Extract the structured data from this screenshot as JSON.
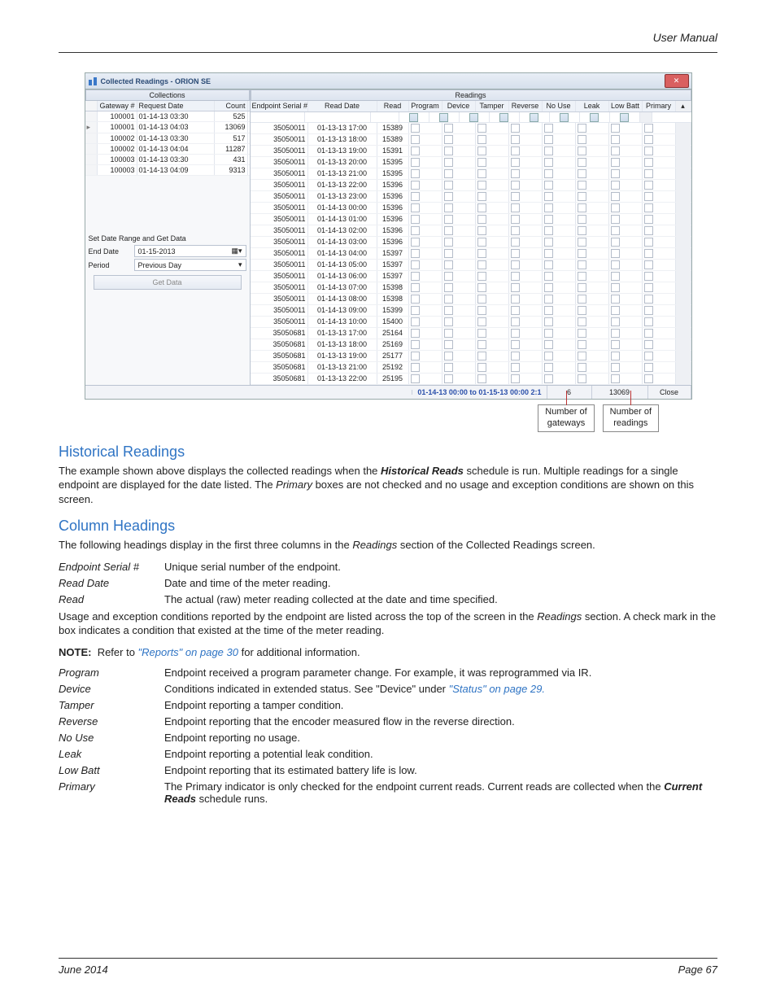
{
  "header": {
    "right": "User Manual"
  },
  "window": {
    "title": "Collected Readings - ORION SE",
    "panes": {
      "left": "Collections",
      "right": "Readings"
    },
    "left": {
      "columns": [
        "Gateway #",
        "Request Date",
        "Count"
      ],
      "rows": [
        {
          "gw": "100001",
          "rq": "01-14-13 03:30",
          "ct": "525"
        },
        {
          "gw": "100001",
          "rq": "01-14-13 04:03",
          "ct": "13069",
          "mark": true
        },
        {
          "gw": "100002",
          "rq": "01-14-13 03:30",
          "ct": "517"
        },
        {
          "gw": "100002",
          "rq": "01-14-13 04:04",
          "ct": "11287"
        },
        {
          "gw": "100003",
          "rq": "01-14-13 03:30",
          "ct": "431"
        },
        {
          "gw": "100003",
          "rq": "01-14-13 04:09",
          "ct": "9313"
        }
      ],
      "range_label": "Set Date Range and Get Data",
      "end_date_label": "End Date",
      "end_date_value": "01-15-2013",
      "period_label": "Period",
      "period_value": "Previous Day",
      "get_data": "Get Data"
    },
    "right": {
      "columns": [
        "Endpoint Serial #",
        "Read Date",
        "Read",
        "Program",
        "Device",
        "Tamper",
        "Reverse",
        "No Use",
        "Leak",
        "Low Batt",
        "Primary"
      ],
      "rows": [
        {
          "s": "35050011",
          "d": "01-13-13  17:00",
          "r": "15389"
        },
        {
          "s": "35050011",
          "d": "01-13-13  18:00",
          "r": "15389"
        },
        {
          "s": "35050011",
          "d": "01-13-13  19:00",
          "r": "15391"
        },
        {
          "s": "35050011",
          "d": "01-13-13  20:00",
          "r": "15395"
        },
        {
          "s": "35050011",
          "d": "01-13-13  21:00",
          "r": "15395"
        },
        {
          "s": "35050011",
          "d": "01-13-13  22:00",
          "r": "15396"
        },
        {
          "s": "35050011",
          "d": "01-13-13  23:00",
          "r": "15396"
        },
        {
          "s": "35050011",
          "d": "01-14-13  00:00",
          "r": "15396"
        },
        {
          "s": "35050011",
          "d": "01-14-13  01:00",
          "r": "15396"
        },
        {
          "s": "35050011",
          "d": "01-14-13  02:00",
          "r": "15396"
        },
        {
          "s": "35050011",
          "d": "01-14-13  03:00",
          "r": "15396"
        },
        {
          "s": "35050011",
          "d": "01-14-13  04:00",
          "r": "15397"
        },
        {
          "s": "35050011",
          "d": "01-14-13  05:00",
          "r": "15397"
        },
        {
          "s": "35050011",
          "d": "01-14-13  06:00",
          "r": "15397"
        },
        {
          "s": "35050011",
          "d": "01-14-13  07:00",
          "r": "15398"
        },
        {
          "s": "35050011",
          "d": "01-14-13  08:00",
          "r": "15398"
        },
        {
          "s": "35050011",
          "d": "01-14-13  09:00",
          "r": "15399"
        },
        {
          "s": "35050011",
          "d": "01-14-13  10:00",
          "r": "15400"
        },
        {
          "s": "35050681",
          "d": "01-13-13  17:00",
          "r": "25164"
        },
        {
          "s": "35050681",
          "d": "01-13-13  18:00",
          "r": "25169"
        },
        {
          "s": "35050681",
          "d": "01-13-13  19:00",
          "r": "25177"
        },
        {
          "s": "35050681",
          "d": "01-13-13  21:00",
          "r": "25192"
        },
        {
          "s": "35050681",
          "d": "01-13-13  22:00",
          "r": "25195"
        }
      ]
    },
    "status": {
      "range": "01-14-13 00:00 to 01-15-13 00:00",
      "ratio": "2:1",
      "gateways": "6",
      "readings": "13069",
      "close": "Close"
    }
  },
  "callouts": {
    "gateways": "Number of\ngateways",
    "readings": "Number of\nreadings"
  },
  "sections": {
    "historical": {
      "title": "Historical Readings",
      "p1a": " The example shown above displays the collected readings when the ",
      "p1b": "Historical Reads",
      "p1c": " schedule is run. Multiple readings for a single endpoint are displayed for the date listed. The ",
      "p1d": "Primary",
      "p1e": " boxes are not checked and no usage and exception conditions are shown on this screen."
    },
    "columns": {
      "title": "Column Headings",
      "intro_a": "The following headings display in the first three columns in the ",
      "intro_b": "Readings",
      "intro_c": " section of the Collected Readings screen.",
      "defs1": [
        {
          "t": "Endpoint Serial #",
          "d": "Unique serial number of the endpoint."
        },
        {
          "t": "Read Date",
          "d": "Date and time of the meter reading."
        },
        {
          "t": "Read",
          "d": "The actual (raw) meter reading collected at the date and time specified."
        }
      ],
      "mid_a": "Usage and exception conditions reported by the endpoint are listed across the top of the screen in the ",
      "mid_b": "Readings",
      "mid_c": " section. A check mark in the box indicates a condition that existed at the time of the meter reading.",
      "note_label": "NOTE:",
      "note_a": "Refer to ",
      "note_link": "\"Reports\" on page 30",
      "note_b": " for additional information.",
      "defs2": [
        {
          "t": "Program",
          "d": "Endpoint received a program parameter change. For example, it was reprogrammed via IR."
        },
        {
          "t": "Device",
          "d_pre": "Conditions indicated in extended status. See \"Device\" under  ",
          "link": "\"Status\" on page 29."
        },
        {
          "t": "Tamper",
          "d": "Endpoint reporting a tamper condition."
        },
        {
          "t": "Reverse",
          "d": "Endpoint reporting that the encoder measured flow in the reverse direction."
        },
        {
          "t": "No Use",
          "d": "Endpoint reporting no usage."
        },
        {
          "t": "Leak",
          "d": "Endpoint reporting a potential leak condition."
        },
        {
          "t": "Low Batt",
          "d": "Endpoint reporting that its estimated battery life is low."
        },
        {
          "t": "Primary",
          "d_pre": "The Primary indicator is only checked for the endpoint current reads. Current reads are collected when the ",
          "bold": "Current Reads",
          "d_post": " schedule runs."
        }
      ]
    }
  },
  "footer": {
    "left": "June 2014",
    "right": "Page 67"
  }
}
